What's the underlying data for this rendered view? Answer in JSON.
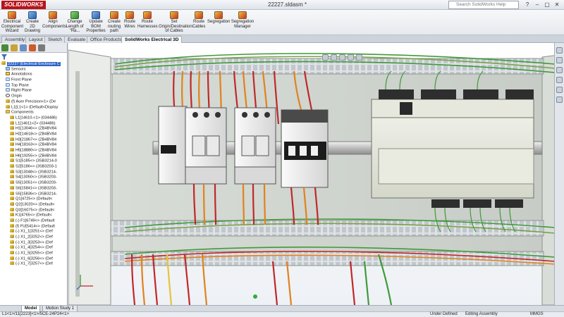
{
  "titlebar": {
    "logo_text": "SOLIDWORKS",
    "document_title": "22227.sldasm *",
    "search_placeholder": "Search SolidWorks Help",
    "controls": [
      "?",
      "–",
      "▢",
      "✕"
    ]
  },
  "commands": [
    {
      "label": "Electrical Component Wizard",
      "icon": "component-wizard-icon"
    },
    {
      "label": "Create 2D Drawing",
      "icon": "drawing-icon"
    },
    {
      "label": "Align Components",
      "icon": "align-icon"
    },
    {
      "label": "Change Length of \"Ra...",
      "icon": "rail-length-icon"
    },
    {
      "label": "Update BOM Properties",
      "icon": "bom-icon"
    },
    {
      "label": "Create routing path",
      "icon": "routing-path-icon"
    },
    {
      "label": "Route Wires",
      "icon": "route-wires-icon"
    },
    {
      "label": "Route Harnesses",
      "icon": "route-harness-icon"
    },
    {
      "label": "Set Origin/Destination of Cables",
      "icon": "set-origin-icon"
    },
    {
      "label": "Route Cables",
      "icon": "route-cables-icon"
    },
    {
      "label": "Segregation",
      "icon": "segregation-icon"
    },
    {
      "label": "Segregation Manager",
      "icon": "segregation-manager-icon"
    }
  ],
  "tabs": [
    "Assembly",
    "Layout",
    "Sketch",
    "Evaluate",
    "Office Products",
    "SolidWorks Electrical 3D"
  ],
  "active_tab": "SolidWorks Electrical 3D",
  "tree": [
    {
      "label": "22227 (Electrical Enclosure C",
      "icon": "assembly",
      "indent": 0,
      "selected": true
    },
    {
      "label": "Sensors",
      "icon": "sensor",
      "indent": 1
    },
    {
      "label": "Annotations",
      "icon": "annot",
      "indent": 1
    },
    {
      "label": "Front Plane",
      "icon": "plane",
      "indent": 1
    },
    {
      "label": "Top Plane",
      "icon": "plane",
      "indent": 1
    },
    {
      "label": "Right Plane",
      "icon": "plane",
      "indent": 1
    },
    {
      "label": "Origin",
      "icon": "origin",
      "indent": 1
    },
    {
      "label": "(f) Auer Precision<1> (De",
      "icon": "part",
      "indent": 1
    },
    {
      "label": "L1[L1<1> (Default<Display",
      "icon": "part",
      "indent": 1
    },
    {
      "label": "Components",
      "icon": "folder",
      "indent": 1
    },
    {
      "label": "L1[14610-<1> (034486)",
      "icon": "part",
      "indent": 2
    },
    {
      "label": "L1[14611<2> (034486)",
      "icon": "part",
      "indent": 2
    },
    {
      "label": "H1[13046<> (ZB4BV84",
      "icon": "part",
      "indent": 2
    },
    {
      "label": "H2[14618<> (ZB4BV84",
      "icon": "part",
      "indent": 2
    },
    {
      "label": "H3[21867<> (ZB4BV84",
      "icon": "part",
      "indent": 2
    },
    {
      "label": "H4[18163<> (ZB4BV84",
      "icon": "part",
      "indent": 2
    },
    {
      "label": "H5[18880<> (ZB4BV84",
      "icon": "part",
      "indent": 2
    },
    {
      "label": "H6[19255<> (ZB4BV84",
      "icon": "part",
      "indent": 2
    },
    {
      "label": "S1[5185<> (3SB3214-0",
      "icon": "part",
      "indent": 2
    },
    {
      "label": "S2[5186<> (3SB3203-1",
      "icon": "part",
      "indent": 2
    },
    {
      "label": "S3[13048<> (3SB3214-",
      "icon": "part",
      "indent": 2
    },
    {
      "label": "S4[13050<> (3SB3203-",
      "icon": "part",
      "indent": 2
    },
    {
      "label": "S5[13051<> (3SB3203-",
      "icon": "part",
      "indent": 2
    },
    {
      "label": "S6[15841<> (3SB3203-",
      "icon": "part",
      "indent": 2
    },
    {
      "label": "S5[15836<> (3SB3214-",
      "icon": "part",
      "indent": 2
    },
    {
      "label": "Q1[4725<> (Default<",
      "icon": "part",
      "indent": 2
    },
    {
      "label": "Q2[13020<> (Default<",
      "icon": "part",
      "indent": 2
    },
    {
      "label": "Q3[16075<> (Default<",
      "icon": "part",
      "indent": 2
    },
    {
      "label": "K1[4765<> (Default<",
      "icon": "part",
      "indent": 2
    },
    {
      "label": "(-) F1[6749<> (Default",
      "icon": "part",
      "indent": 2
    },
    {
      "label": "(f) FU[5414<> (Default",
      "icon": "part",
      "indent": 2
    },
    {
      "label": "(-) X1_1[3251<> (Def",
      "icon": "part",
      "indent": 2
    },
    {
      "label": "(-) X1_2[3252<> (Def",
      "icon": "part",
      "indent": 2
    },
    {
      "label": "(-) X1_3[3253<> (Def",
      "icon": "part",
      "indent": 2
    },
    {
      "label": "(-) X1_4[3254<> (Def",
      "icon": "part",
      "indent": 2
    },
    {
      "label": "(-) X1_5[3255<> (Def",
      "icon": "part",
      "indent": 2
    },
    {
      "label": "(-) X1_6[3256<> (Def",
      "icon": "part",
      "indent": 2
    },
    {
      "label": "(-) X1_7[3257<> (Def",
      "icon": "part",
      "indent": 2
    }
  ],
  "model_tabs": [
    "Model",
    "Motion Study 1"
  ],
  "active_model_tab": "Model",
  "status": {
    "path": "L1<1>/11[2223]<1>/5CE-24P24<1>",
    "state": "Under Defined",
    "mode": "Editing Assembly",
    "units": "MMGS"
  },
  "colors": {
    "logo_red": "#b8141a",
    "selection_blue": "#2f64c6",
    "wire_red": "#c0282a",
    "wire_orange": "#e0821e",
    "wire_green": "#3f9a3a",
    "wire_yellow": "#e6c33a"
  }
}
